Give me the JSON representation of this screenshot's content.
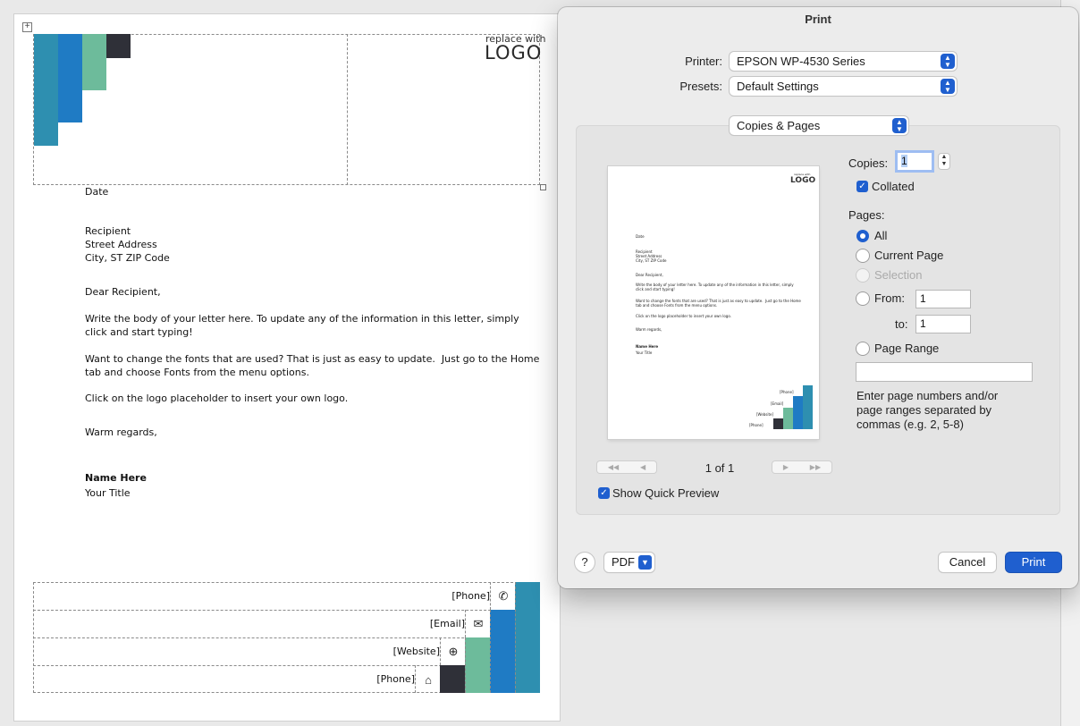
{
  "document": {
    "logo_small": "replace with",
    "logo_big": "LOGO",
    "date": "Date",
    "recipient_lines": [
      "Recipient",
      "Street Address",
      "City, ST ZIP Code"
    ],
    "greeting": "Dear Recipient,",
    "body_paragraphs": [
      "Write the body of your letter here. To update any of the information in this letter, simply\nclick and start typing!",
      "Want to change the fonts that are used? That is just as easy to update.  Just go to the Home\ntab and choose Fonts from the menu options.",
      "Click on the logo placeholder to insert your own logo."
    ],
    "closing": "Warm regards,",
    "name": "Name Here",
    "title": "Your Title",
    "footer": [
      {
        "label": "[Phone]",
        "icon": "phone-icon",
        "glyph": "✆"
      },
      {
        "label": "[Email]",
        "icon": "email-icon",
        "glyph": "✉"
      },
      {
        "label": "[Website]",
        "icon": "globe-icon",
        "glyph": "⊕"
      },
      {
        "label": "[Phone]",
        "icon": "home-icon",
        "glyph": "⌂"
      }
    ],
    "colors": {
      "teal": "#2e8fb0",
      "blue": "#1f7bc4",
      "green": "#6dbb9b",
      "dark": "#2f3038"
    }
  },
  "dialog": {
    "title": "Print",
    "printer_label": "Printer:",
    "printer_value": "EPSON WP-4530 Series",
    "presets_label": "Presets:",
    "presets_value": "Default Settings",
    "section_value": "Copies & Pages",
    "copies_label": "Copies:",
    "copies_value": "1",
    "collated_label": "Collated",
    "pages_label": "Pages:",
    "radio_all": "All",
    "radio_current": "Current Page",
    "radio_selection": "Selection",
    "radio_from": "From:",
    "from_value": "1",
    "to_label": "to:",
    "to_value": "1",
    "radio_range": "Page Range",
    "range_hint": "Enter page numbers and/or\npage ranges separated by\ncommas (e.g. 2, 5-8)",
    "page_indicator": "1 of 1",
    "quick_preview_label": "Show Quick Preview",
    "help_label": "?",
    "pdf_label": "PDF",
    "cancel_label": "Cancel",
    "print_label": "Print",
    "preview_text": {
      "logo_small": "replace with",
      "logo_big": "LOGO",
      "date": "Date",
      "recipient": "Recipient\nStreet Address\nCity, ST ZIP Code",
      "greeting": "Dear Recipient,",
      "p1": "Write the body of your letter here. To update any of the information in this letter, simply\nclick and start typing!",
      "p2": "Want to change the fonts that are used? That is just as easy to update.  Just go to the Home\ntab and choose Fonts from the menu options.",
      "p3": "Click on the logo placeholder to insert your own logo.",
      "closing": "Warm regards,",
      "name": "Name Here",
      "title": "Your Title",
      "f1": "[Phone]",
      "f2": "[Email]",
      "f3": "[Website]",
      "f4": "[Phone]"
    },
    "accent": "#1f5fcf"
  }
}
